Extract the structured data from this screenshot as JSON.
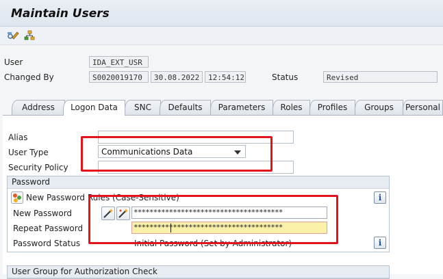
{
  "window": {
    "title": "Maintain Users"
  },
  "toolbar": {
    "items": [
      {
        "icon": "display-change-icon"
      },
      {
        "icon": "hierarchy-icon"
      }
    ]
  },
  "header": {
    "user_label": "User",
    "user_value": "IDA_EXT_USR",
    "changed_by_label": "Changed By",
    "changed_by_value": "S0020019170",
    "changed_date": "30.08.2022",
    "changed_time": "12:54:12",
    "status_label": "Status",
    "status_value": "Revised"
  },
  "tabs": [
    {
      "label": "Address"
    },
    {
      "label": "Logon Data",
      "active": true
    },
    {
      "label": "SNC"
    },
    {
      "label": "Defaults"
    },
    {
      "label": "Parameters"
    },
    {
      "label": "Roles"
    },
    {
      "label": "Profiles"
    },
    {
      "label": "Groups"
    },
    {
      "label": "Personal"
    }
  ],
  "logon": {
    "alias_label": "Alias",
    "alias_value": "",
    "user_type_label": "User Type",
    "user_type_value": "Communications Data",
    "security_policy_label": "Security Policy",
    "security_policy_value": ""
  },
  "password": {
    "group_title": "Password",
    "rules_text": "New Password Rules (Case-Sensitive)",
    "new_label": "New Password",
    "new_value": "**************************************",
    "repeat_label": "Repeat Password",
    "repeat_value": "**************************************",
    "status_label": "Password Status",
    "status_value": "Initial Password (Set by Administrator)"
  },
  "next_group": {
    "title": "User Group for Authorization Check"
  },
  "colors": {
    "highlight": "#e4121a",
    "focus_field": "#fbf1a8",
    "tab_active": "#ffffff"
  }
}
